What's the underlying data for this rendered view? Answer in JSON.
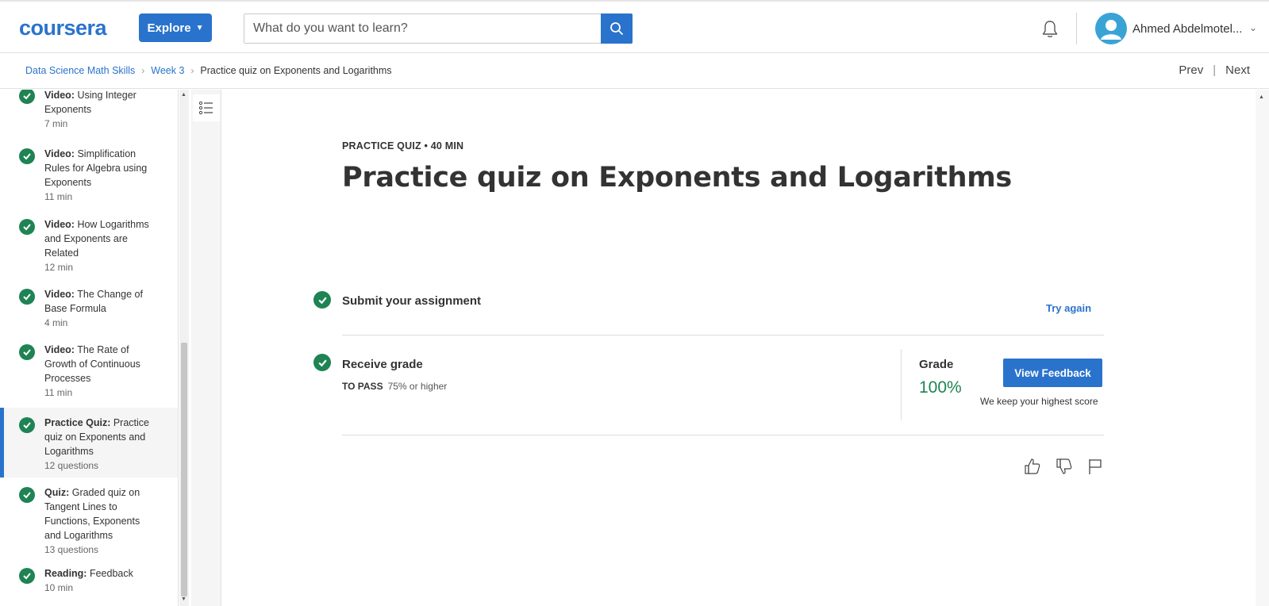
{
  "header": {
    "logo": "coursera",
    "explore_label": "Explore",
    "search": {
      "placeholder": "What do you want to learn?",
      "value": ""
    },
    "user_name": "Ahmed Abdelmotel..."
  },
  "breadcrumb": {
    "items": [
      "Data Science Math Skills",
      "Week 3"
    ],
    "current": "Practice quiz on Exponents and Logarithms",
    "prev_label": "Prev",
    "next_label": "Next",
    "divider": "|"
  },
  "sidebar": {
    "items": [
      {
        "kind": "Video:",
        "title": " Using Integer Exponents",
        "meta": "7 min"
      },
      {
        "kind": "Video:",
        "title": " Simplification Rules for Algebra using Exponents",
        "meta": "11 min"
      },
      {
        "kind": "Video:",
        "title": " How Logarithms and Exponents are Related",
        "meta": "12 min"
      },
      {
        "kind": "Video:",
        "title": " The Change of Base Formula",
        "meta": "4 min"
      },
      {
        "kind": "Video:",
        "title": " The Rate of Growth of Continuous Processes",
        "meta": "11 min"
      },
      {
        "kind": "Practice Quiz:",
        "title": " Practice quiz on Exponents and Logarithms",
        "meta": "12 questions"
      },
      {
        "kind": "Quiz:",
        "title": " Graded quiz on Tangent Lines to Functions, Exponents and Logarithms",
        "meta": "13 questions"
      },
      {
        "kind": "Reading:",
        "title": " Feedback",
        "meta": "10 min"
      }
    ]
  },
  "main": {
    "kicker": "PRACTICE QUIZ • 40 MIN",
    "title": "Practice quiz on Exponents and Logarithms",
    "step1": {
      "title": "Submit your assignment",
      "action": "Try again"
    },
    "step2": {
      "title": "Receive grade",
      "to_pass_label": "TO PASS",
      "to_pass_value": "75% or higher",
      "grade_label": "Grade",
      "grade_value": "100%",
      "feedback_button": "View Feedback",
      "note": "We keep your highest score"
    }
  },
  "colors": {
    "brand_blue": "#2a73cc",
    "success_green": "#1f8354"
  },
  "icons": [
    "search-icon",
    "bell-icon",
    "user-avatar-icon",
    "check-icon",
    "list-icon",
    "thumbs-up-icon",
    "thumbs-down-icon",
    "flag-icon"
  ]
}
